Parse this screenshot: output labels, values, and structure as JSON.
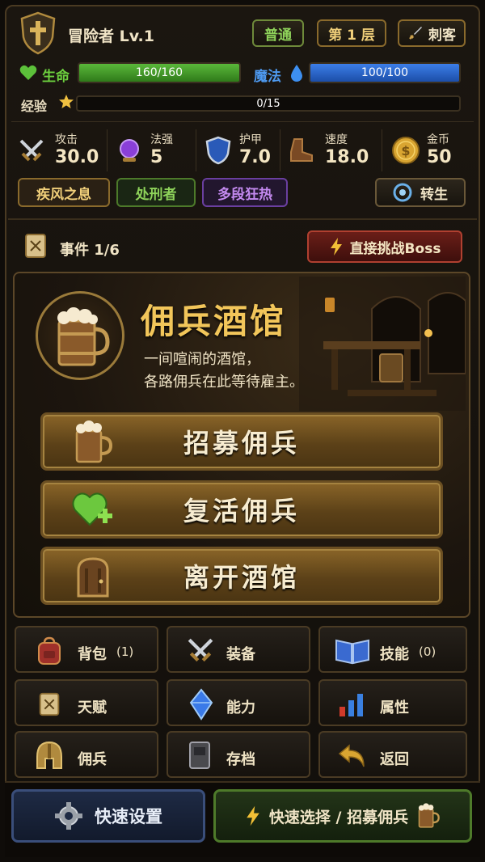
{
  "player": {
    "title": "冒险者 Lv.1"
  },
  "header_buttons": {
    "difficulty": "普通",
    "floor": "第 1 层",
    "class": "刺客"
  },
  "hp": {
    "label": "生命",
    "text": "160/160",
    "fraction": 1.0,
    "color": "#3f9a22"
  },
  "mp": {
    "label": "魔法",
    "text": "100/100",
    "fraction": 1.0,
    "color": "#2a6ad8"
  },
  "xp": {
    "label": "经验",
    "text": "0/15",
    "fraction": 0.0
  },
  "stats": [
    {
      "label": "攻击",
      "value": "30.0",
      "icon": "crossed-swords-icon"
    },
    {
      "label": "法强",
      "value": "5",
      "icon": "magic-orb-icon"
    },
    {
      "label": "护甲",
      "value": "7.0",
      "icon": "shield-icon"
    },
    {
      "label": "速度",
      "value": "18.0",
      "icon": "boot-icon"
    },
    {
      "label": "金币",
      "value": "50",
      "icon": "gold-coin-icon"
    }
  ],
  "traits": [
    "疾风之息",
    "处刑者",
    "多段狂热"
  ],
  "rebirth_label": "转生",
  "event": {
    "counter": "事件 1/6",
    "boss_label": "直接挑战Boss"
  },
  "tavern": {
    "title": "佣兵酒馆",
    "desc_line1": "一间喧闹的酒馆，",
    "desc_line2": "各路佣兵在此等待雇主。",
    "actions": [
      "招募佣兵",
      "复活佣兵",
      "离开酒馆"
    ]
  },
  "menu": [
    {
      "label": "背包",
      "count": "(1)",
      "icon": "backpack-icon"
    },
    {
      "label": "装备",
      "count": "",
      "icon": "crossed-swords-icon"
    },
    {
      "label": "技能",
      "count": "(0)",
      "icon": "spellbook-icon"
    },
    {
      "label": "天赋",
      "count": "",
      "icon": "scroll-icon"
    },
    {
      "label": "能力",
      "count": "",
      "icon": "crystal-icon"
    },
    {
      "label": "属性",
      "count": "",
      "icon": "bar-chart-icon"
    },
    {
      "label": "佣兵",
      "count": "",
      "icon": "helmet-icon"
    },
    {
      "label": "存档",
      "count": "",
      "icon": "save-book-icon"
    },
    {
      "label": "返回",
      "count": "",
      "icon": "return-arrow-icon"
    }
  ],
  "bottom": {
    "settings_label": "快速设置",
    "quick_label": "快速选择 / 招募佣兵"
  }
}
